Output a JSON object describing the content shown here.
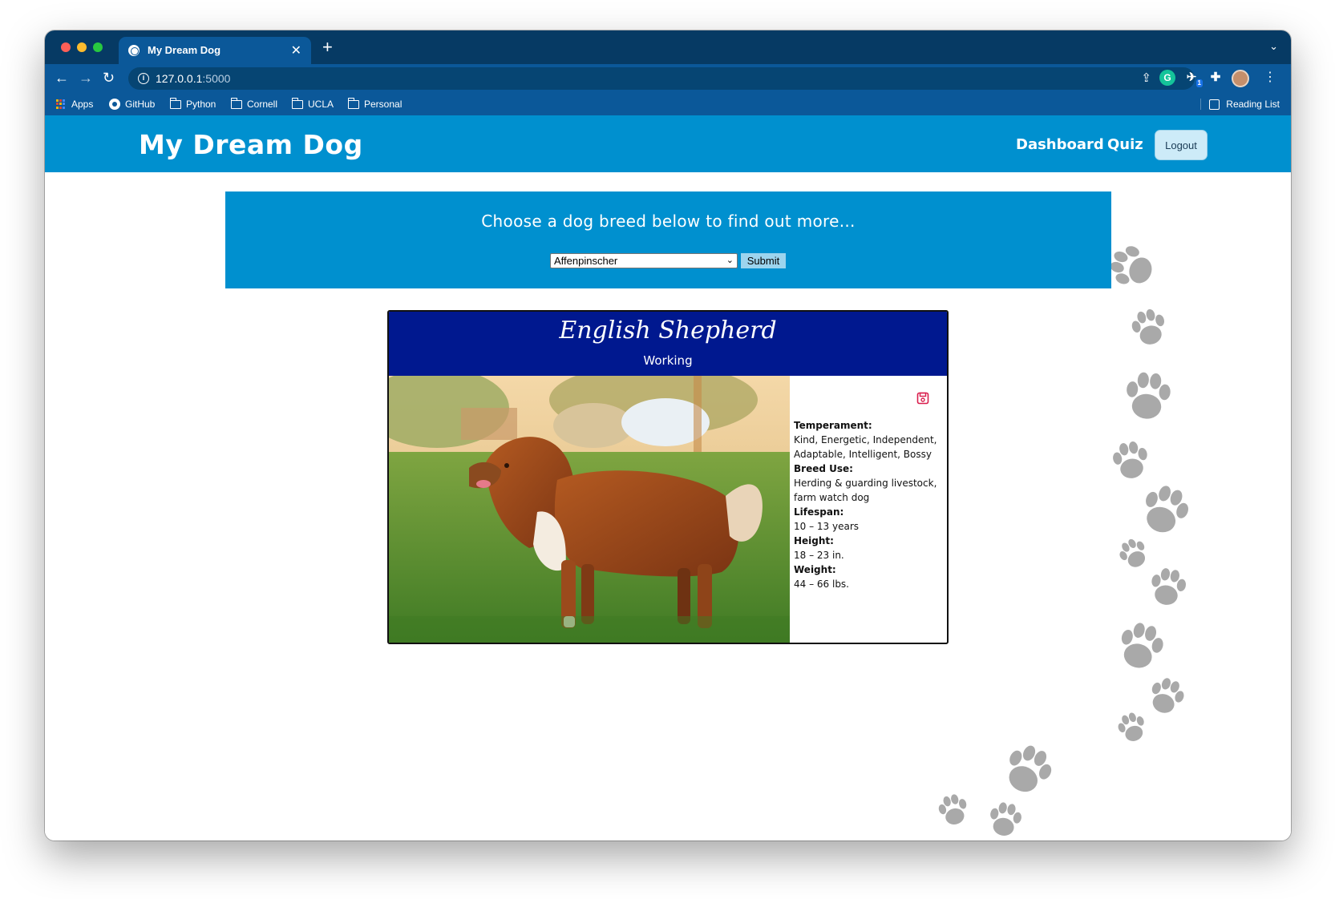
{
  "browser": {
    "tab_title": "My Dream Dog",
    "url_host": "127.0.0.1",
    "url_port": ":5000",
    "extension_badge": "1",
    "bookmarks": [
      {
        "label": "Apps",
        "icon": "apps-grid-icon"
      },
      {
        "label": "GitHub",
        "icon": "github-icon"
      },
      {
        "label": "Python",
        "icon": "folder-icon"
      },
      {
        "label": "Cornell",
        "icon": "folder-icon"
      },
      {
        "label": "UCLA",
        "icon": "folder-icon"
      },
      {
        "label": "Personal",
        "icon": "folder-icon"
      }
    ],
    "reading_list": "Reading List"
  },
  "site": {
    "brand": "My Dream Dog",
    "nav": {
      "dashboard": "Dashboard",
      "quiz": "Quiz",
      "logout": "Logout"
    }
  },
  "chooser": {
    "heading": "Choose a dog breed below to find out more...",
    "selected_breed": "Affenpinscher",
    "submit_label": "Submit"
  },
  "breed_card": {
    "name": "English Shepherd",
    "group": "Working",
    "photo_description": "Brown and white English Shepherd standing on grass",
    "facts": [
      {
        "label": "Temperament:",
        "value": "Kind, Energetic, Independent, Adaptable, Intelligent, Bossy"
      },
      {
        "label": "Breed Use:",
        "value": "Herding & guarding livestock, farm watch dog"
      },
      {
        "label": "Lifespan:",
        "value": "10 – 13 years"
      },
      {
        "label": "Height:",
        "value": "18 – 23 in."
      },
      {
        "label": "Weight:",
        "value": "44 – 66 lbs."
      }
    ]
  },
  "colors": {
    "browser_frame": "#063a64",
    "browser_toolbar": "#0b5899",
    "site_blue": "#0090cf",
    "card_header": "#00188f",
    "save_icon": "#d91e4d",
    "paw_print": "#a9a9a9"
  }
}
